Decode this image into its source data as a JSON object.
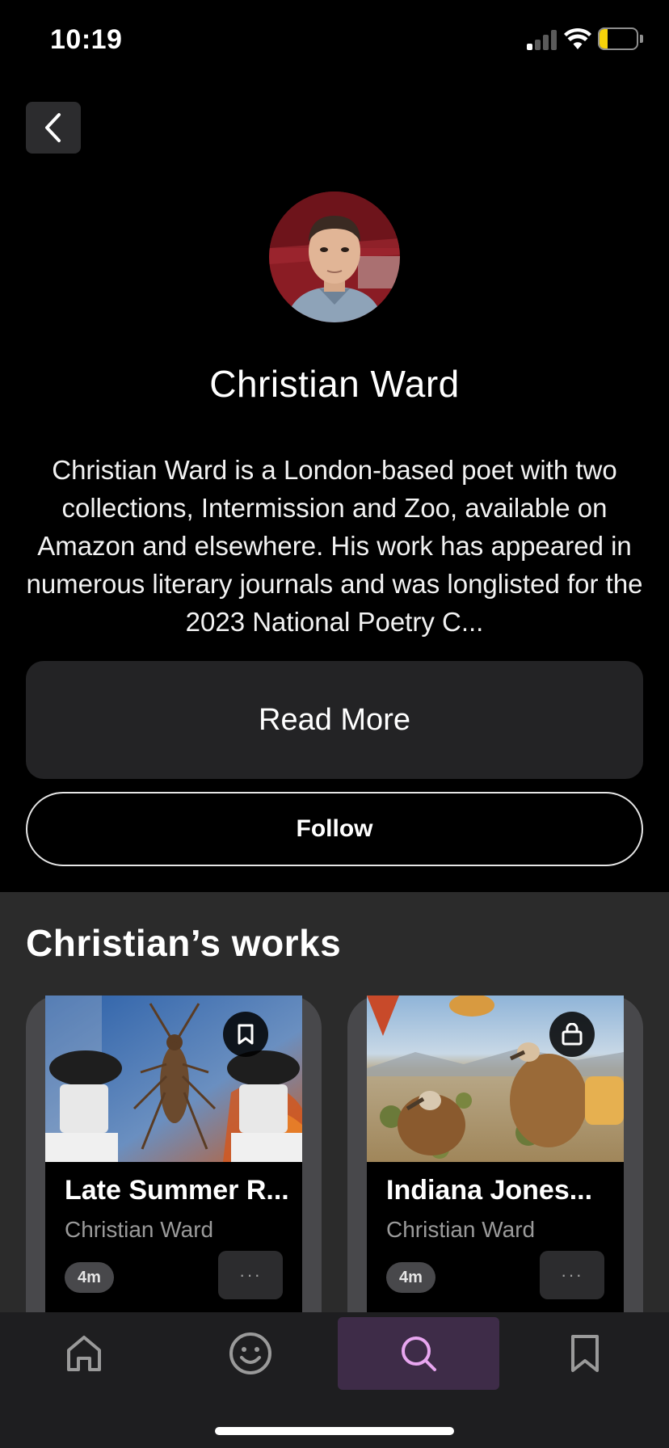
{
  "status_bar": {
    "time": "10:19",
    "battery": "13",
    "battery_color": "#f5d20a"
  },
  "header": {
    "back_icon": "chevron-left-icon"
  },
  "author": {
    "name": "Christian Ward",
    "bio": "Christian Ward is a London-based poet with two collections, Intermission and Zoo, available on Amazon and elsewhere. His work has appeared in numerous literary journals and was longlisted for the 2023 National Poetry C...",
    "avatar_icon": "author-avatar"
  },
  "actions": {
    "read_more": "Read More",
    "follow": "Follow"
  },
  "works": {
    "title": "Christian’s works",
    "cards": [
      {
        "title": "Late Summer R...",
        "author": "Christian Ward",
        "duration": "4m",
        "more": "···",
        "badge_icon": "bookmark-icon"
      },
      {
        "title": "Indiana Jones...",
        "author": "Christian Ward",
        "duration": "4m",
        "more": "···",
        "badge_icon": "lock-icon"
      }
    ]
  },
  "tab_bar": {
    "tabs": [
      {
        "icon": "home-icon",
        "active": false
      },
      {
        "icon": "smiley-icon",
        "active": false
      },
      {
        "icon": "search-icon",
        "active": true
      },
      {
        "icon": "bookmark-icon",
        "active": false
      }
    ],
    "active_color": "#e8a6f0"
  }
}
